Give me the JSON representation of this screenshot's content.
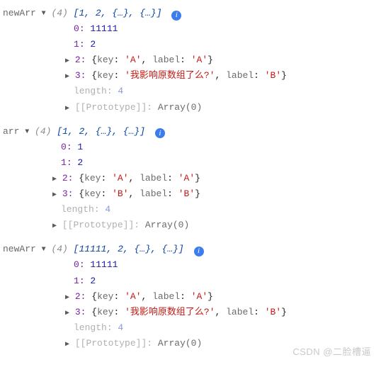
{
  "blocks": [
    {
      "var_name": "newArr",
      "length_label": "(4)",
      "summary": "[1, 2, {…}, {…}]",
      "indent_class": "indent-1",
      "idx0": "0",
      "val0": "11111",
      "idx1": "1",
      "val1": "2",
      "idx2": "2",
      "obj2_open": "{",
      "obj2_key_k": "key",
      "obj2_key_v": "'A'",
      "obj2_lbl_k": "label",
      "obj2_lbl_v": "'A'",
      "obj2_close": "}",
      "idx3": "3",
      "obj3_open": "{",
      "obj3_key_k": "key",
      "obj3_key_v": "'我影响原数组了么?'",
      "obj3_lbl_k": "label",
      "obj3_lbl_v": "'B'",
      "obj3_close": "}",
      "length_k": "length",
      "length_v": "4",
      "proto_k": "[[Prototype]]",
      "proto_v": "Array(0)"
    },
    {
      "var_name": "arr",
      "length_label": "(4)",
      "summary": "[1, 2, {…}, {…}]",
      "indent_class": "indent-1b",
      "idx0": "0",
      "val0": "1",
      "idx1": "1",
      "val1": "2",
      "idx2": "2",
      "obj2_open": "{",
      "obj2_key_k": "key",
      "obj2_key_v": "'A'",
      "obj2_lbl_k": "label",
      "obj2_lbl_v": "'A'",
      "obj2_close": "}",
      "idx3": "3",
      "obj3_open": "{",
      "obj3_key_k": "key",
      "obj3_key_v": "'B'",
      "obj3_lbl_k": "label",
      "obj3_lbl_v": "'B'",
      "obj3_close": "}",
      "length_k": "length",
      "length_v": "4",
      "proto_k": "[[Prototype]]",
      "proto_v": "Array(0)"
    },
    {
      "var_name": "newArr",
      "length_label": "(4)",
      "summary": "[11111, 2, {…}, {…}]",
      "indent_class": "indent-1",
      "idx0": "0",
      "val0": "11111",
      "idx1": "1",
      "val1": "2",
      "idx2": "2",
      "obj2_open": "{",
      "obj2_key_k": "key",
      "obj2_key_v": "'A'",
      "obj2_lbl_k": "label",
      "obj2_lbl_v": "'A'",
      "obj2_close": "}",
      "idx3": "3",
      "obj3_open": "{",
      "obj3_key_k": "key",
      "obj3_key_v": "'我影响原数组了么?'",
      "obj3_lbl_k": "label",
      "obj3_lbl_v": "'B'",
      "obj3_close": "}",
      "length_k": "length",
      "length_v": "4",
      "proto_k": "[[Prototype]]",
      "proto_v": "Array(0)"
    }
  ],
  "watermark": "CSDN @二脸槽逼"
}
